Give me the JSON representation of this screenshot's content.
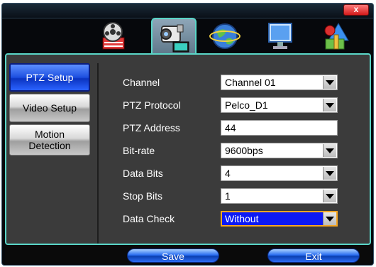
{
  "window": {
    "close_label": "x"
  },
  "tabs": [
    {
      "icon": "film-icon",
      "active": false
    },
    {
      "icon": "camera-icon",
      "active": true
    },
    {
      "icon": "globe-icon",
      "active": false
    },
    {
      "icon": "monitor-icon",
      "active": false
    },
    {
      "icon": "tools-icon",
      "active": false
    }
  ],
  "sidebar": {
    "items": [
      {
        "label": "PTZ Setup",
        "active": true
      },
      {
        "label": "Video Setup",
        "active": false
      },
      {
        "label": "Motion Detection",
        "active": false
      }
    ]
  },
  "form": {
    "channel": {
      "label": "Channel",
      "value": "Channel 01"
    },
    "protocol": {
      "label": "PTZ Protocol",
      "value": "Pelco_D1"
    },
    "address": {
      "label": "PTZ Address",
      "value": "44"
    },
    "bitrate": {
      "label": "Bit-rate",
      "value": "9600bps"
    },
    "databits": {
      "label": "Data Bits",
      "value": "4"
    },
    "stopbits": {
      "label": "Stop Bits",
      "value": "1"
    },
    "datacheck": {
      "label": "Data Check",
      "value": "Without"
    }
  },
  "footer": {
    "save_label": "Save",
    "exit_label": "Exit"
  },
  "colors": {
    "accent": "#5ad6c8",
    "selection": "#0c19f5",
    "button_blue": "#2a6ef0",
    "close_red": "#d31b1b"
  }
}
